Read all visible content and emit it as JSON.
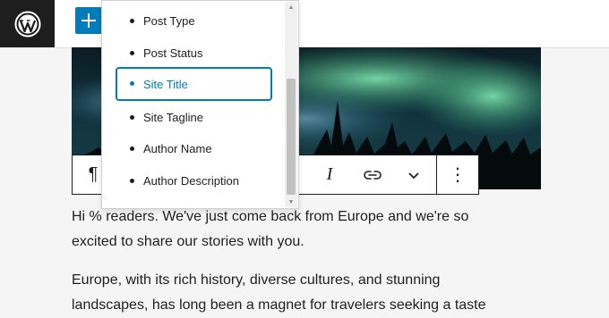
{
  "colors": {
    "accent": "#007cba",
    "dark": "#1e1e1e"
  },
  "header": {
    "logo_icon": "wordpress-logo-icon",
    "add_icon": "plus-icon"
  },
  "dropdown": {
    "items": [
      "Post Type",
      "Post Status",
      "Site Title",
      "Site Tagline",
      "Author Name",
      "Author Description"
    ],
    "selected": "Site Title"
  },
  "toolbar": {
    "icons": [
      "paragraph-icon",
      "italic-icon",
      "link-icon",
      "chevron-down-icon",
      "more-options-icon"
    ],
    "paragraph_glyph": "¶",
    "italic_glyph": "I",
    "more_glyph": "⋮"
  },
  "content": {
    "para1_line1": "Hi % readers. We've just come back from Europe and we're so",
    "para1_line2": "excited to share our stories with you.",
    "para2_line1": "Europe, with its rich history, diverse cultures, and stunning",
    "para2_line2": "landscapes, has long been a magnet for travelers seeking a taste"
  }
}
